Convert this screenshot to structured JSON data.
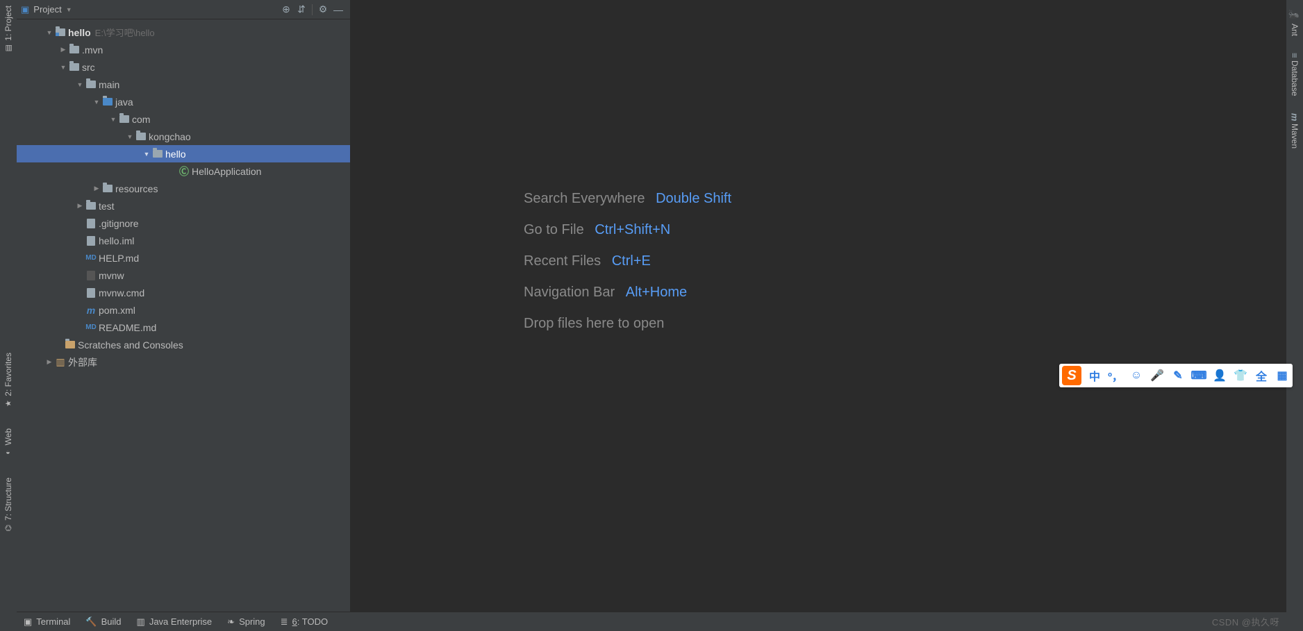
{
  "left_tabs": {
    "project": "1: Project",
    "favorites": "2: Favorites",
    "web": "Web",
    "structure": "7: Structure"
  },
  "right_tabs": {
    "ant": "Ant",
    "database": "Database",
    "maven": "Maven"
  },
  "proj_header": {
    "title": "Project"
  },
  "tree": {
    "root": {
      "label": "hello",
      "path": "E:\\学习吧\\hello"
    },
    "mvn": ".mvn",
    "src": "src",
    "main": "main",
    "java": "java",
    "com": "com",
    "kongchao": "kongchao",
    "hello_pkg": "hello",
    "hello_app": "HelloApplication",
    "resources": "resources",
    "test": "test",
    "gitignore": ".gitignore",
    "hello_iml": "hello.iml",
    "help_md": "HELP.md",
    "mvnw": "mvnw",
    "mvnw_cmd": "mvnw.cmd",
    "pom_xml": "pom.xml",
    "readme_md": "README.md",
    "scratches": "Scratches and Consoles",
    "ext_lib": "外部库"
  },
  "editor_hints": [
    {
      "label": "Search Everywhere",
      "shortcut": "Double Shift"
    },
    {
      "label": "Go to File",
      "shortcut": "Ctrl+Shift+N"
    },
    {
      "label": "Recent Files",
      "shortcut": "Ctrl+E"
    },
    {
      "label": "Navigation Bar",
      "shortcut": "Alt+Home"
    },
    {
      "label": "Drop files here to open",
      "shortcut": ""
    }
  ],
  "bottom": {
    "terminal": "Terminal",
    "build": "Build",
    "java_ee": "Java Enterprise",
    "spring": "Spring",
    "todo": "6: TODO",
    "watermark": "CSDN @执久呀"
  },
  "ime": {
    "logo": "S",
    "lang": "中",
    "punct": "º，",
    "full": "全"
  }
}
